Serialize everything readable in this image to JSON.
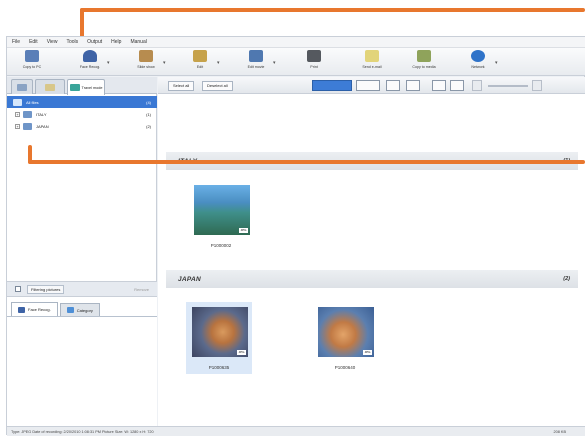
{
  "menu": [
    "File",
    "Edit",
    "View",
    "Tools",
    "Output",
    "Help",
    "Manual"
  ],
  "toolbar": [
    {
      "label": "Copy to PC",
      "icon": "copy-to-pc-icon"
    },
    {
      "label": "Face Recog.",
      "icon": "face-recognition-icon"
    },
    {
      "label": "Slide show",
      "icon": "slideshow-icon"
    },
    {
      "label": "Edit",
      "icon": "edit-icon"
    },
    {
      "label": "Edit movie",
      "icon": "edit-movie-icon"
    },
    {
      "label": "Print",
      "icon": "print-icon"
    },
    {
      "label": "Send e-mail",
      "icon": "email-icon"
    },
    {
      "label": "Copy to media",
      "icon": "copy-to-media-icon"
    },
    {
      "label": "Network",
      "icon": "network-icon"
    }
  ],
  "left_tabs": {
    "active_label": "Travel mode"
  },
  "tree": [
    {
      "label": "All files",
      "count": "(4)"
    },
    {
      "label": "ITALY",
      "count": "(1)"
    },
    {
      "label": "JAPAN",
      "count": "(2)"
    }
  ],
  "lower": {
    "filter_label": "Filtering pictures",
    "filter_right": "Remove",
    "tabs": [
      "Face Recog.",
      "Category"
    ]
  },
  "right_bar": {
    "select_all": "Select all",
    "deselect_all": "Deselect all"
  },
  "groups": [
    {
      "title": "ITALY",
      "count": "(1)",
      "items": [
        {
          "caption": "P1000002",
          "badge": "JPG"
        }
      ]
    },
    {
      "title": "JAPAN",
      "count": "(2)",
      "items": [
        {
          "caption": "P1000635",
          "badge": "JPG"
        },
        {
          "caption": "P1000640",
          "badge": "JPG"
        }
      ]
    }
  ],
  "status": {
    "text": "Type: JPEG Date of recording: 2/20/2010 1:08:31 PM Picture Size: W: 1280 x H: 720",
    "size": "208 KB"
  },
  "colors": {
    "accent": "#3a78d4",
    "callout": "#e8772e",
    "group_header": "#dde1e6"
  }
}
